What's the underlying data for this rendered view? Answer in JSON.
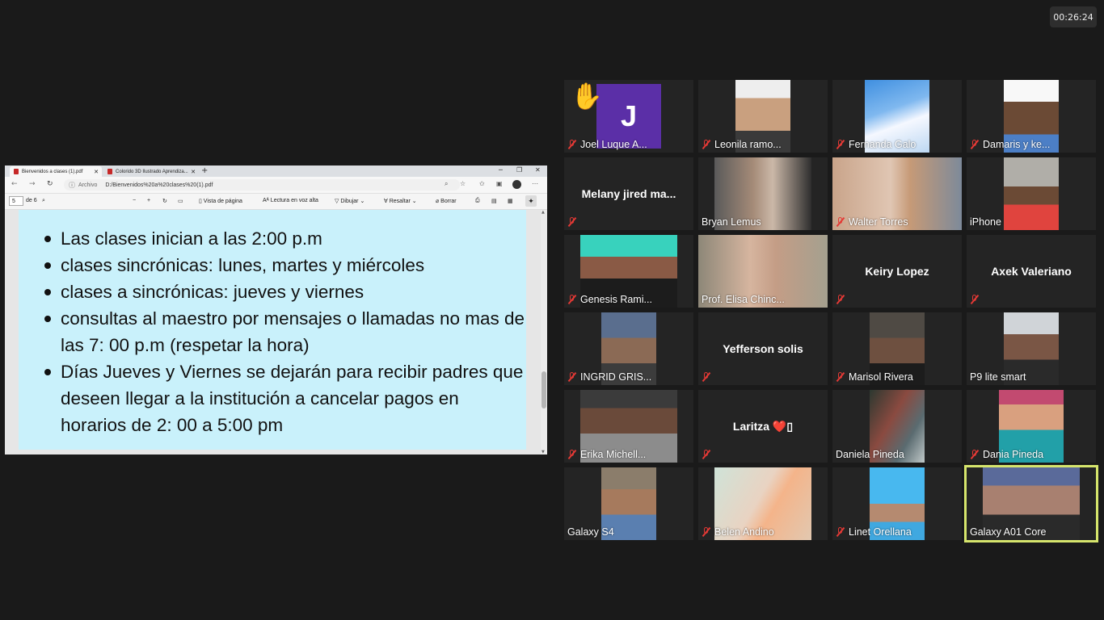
{
  "timer": "00:26:24",
  "browser": {
    "tabs": [
      {
        "label": "Bienvenidos a clases (1).pdf",
        "active": true
      },
      {
        "label": "Colorido 3D Ilustrado Aprendiza...",
        "active": false
      }
    ],
    "origin_label": "Archivo",
    "url": "D:/Bienvenidos%20a%20clases%20(1).pdf",
    "pdf_toolbar": {
      "page_current": "5",
      "page_total": "de 6",
      "page_view": "Vista de página",
      "read_aloud": "Lectura en voz alta",
      "draw": "Dibujar",
      "highlight": "Resaltar",
      "erase": "Borrar"
    }
  },
  "slide": {
    "bullets": [
      "Las clases inician a las 2:00 p.m",
      "clases sincrónicas: lunes, martes y miércoles",
      "clases a sincrónicas: jueves y viernes",
      "consultas al maestro por mensajes o llamadas no mas de las 7: 00 p.m (respetar la hora)",
      "Días Jueves y Viernes se dejarán para recibir padres que deseen llegar a la institución a cancelar pagos en horarios de 2: 00 a 5:00 pm"
    ]
  },
  "participants": [
    {
      "name": "Joel Luque A...",
      "initial": "J",
      "muted": true,
      "hand": true
    },
    {
      "name": "Leonila ramo...",
      "muted": true
    },
    {
      "name": "Fernanda Galo",
      "muted": true
    },
    {
      "name": "Damaris y ke...",
      "muted": true
    },
    {
      "name": "",
      "big_name": "Melany jired ma...",
      "muted": true
    },
    {
      "name": "Bryan Lemus",
      "muted": false
    },
    {
      "name": "Walter Torres",
      "muted": true
    },
    {
      "name": "iPhone",
      "muted": false
    },
    {
      "name": "Genesis Rami...",
      "muted": true
    },
    {
      "name": "Prof. Elisa Chinc...",
      "muted": false
    },
    {
      "name": "",
      "big_name": "Keiry Lopez",
      "muted": true
    },
    {
      "name": "",
      "big_name": "Axek Valeriano",
      "muted": true
    },
    {
      "name": "INGRID GRIS...",
      "muted": true
    },
    {
      "name": "",
      "big_name": "Yefferson solis",
      "muted": true
    },
    {
      "name": "Marisol Rivera",
      "muted": true
    },
    {
      "name": "P9 lite smart",
      "muted": false
    },
    {
      "name": "Erika Michell...",
      "muted": true
    },
    {
      "name": "",
      "big_name": "Laritza ❤️▯",
      "muted": true
    },
    {
      "name": "Daniela Pineda",
      "muted": false
    },
    {
      "name": "Dania Pineda",
      "muted": true
    },
    {
      "name": "Galaxy S4",
      "muted": false
    },
    {
      "name": "Belen Andino",
      "muted": true
    },
    {
      "name": "Linet Orellana",
      "muted": true
    },
    {
      "name": "Galaxy A01 Core",
      "muted": false,
      "active_speaker": true
    }
  ]
}
